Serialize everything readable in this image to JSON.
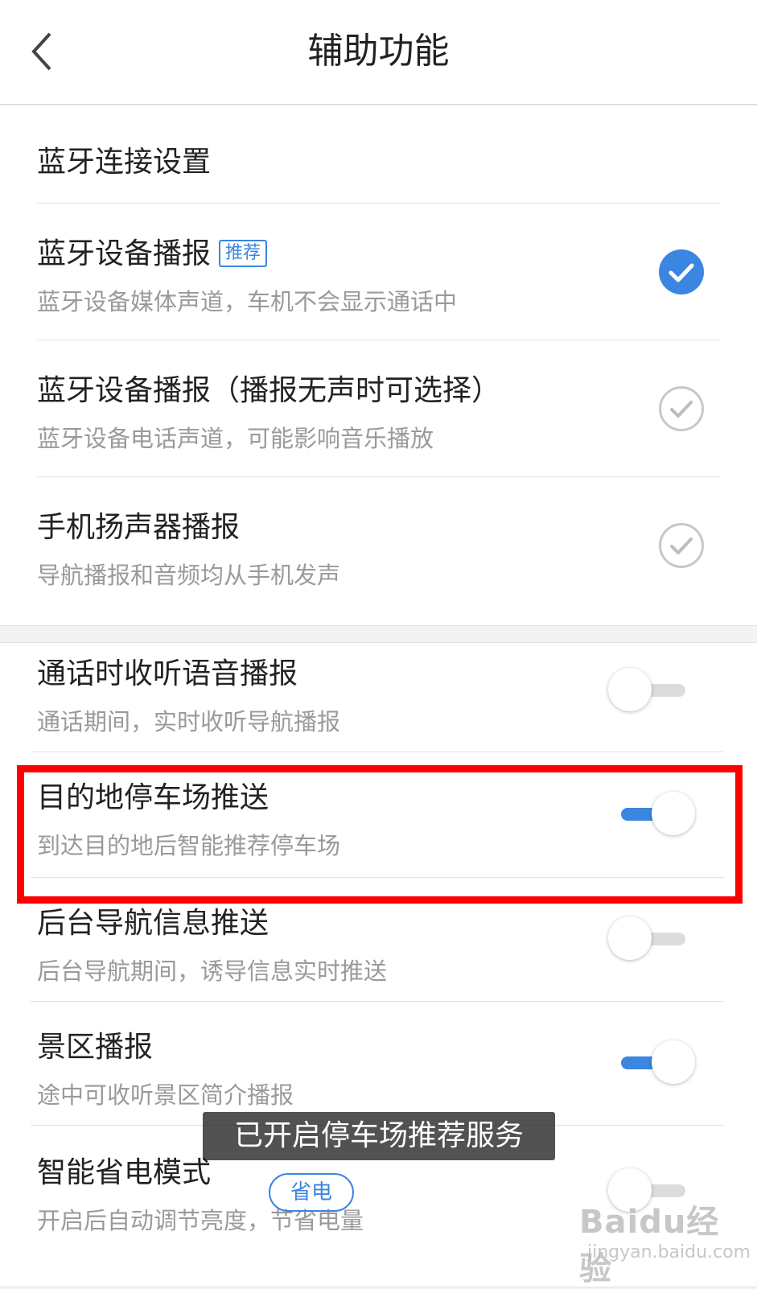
{
  "header": {
    "title": "辅助功能"
  },
  "audio_group": {
    "section_title": "蓝牙连接设置",
    "options": [
      {
        "title": "蓝牙设备播报",
        "tag": "推荐",
        "subtitle": "蓝牙设备媒体声道，车机不会显示通话中",
        "selected": true
      },
      {
        "title": "蓝牙设备播报（播报无声时可选择）",
        "subtitle": "蓝牙设备电话声道，可能影响音乐播放",
        "selected": false
      },
      {
        "title": "手机扬声器播报",
        "subtitle": "导航播报和音频均从手机发声",
        "selected": false
      }
    ]
  },
  "toggle_group": {
    "items": [
      {
        "title": "通话时收听语音播报",
        "subtitle": "通话期间，实时收听导航播报",
        "enabled": false
      },
      {
        "title": "目的地停车场推送",
        "subtitle": "到达目的地后智能推荐停车场",
        "enabled": true
      },
      {
        "title": "后台导航信息推送",
        "subtitle": "后台导航期间，诱导信息实时推送",
        "enabled": false
      },
      {
        "title": "景区播报",
        "subtitle": "途中可收听景区简介播报",
        "enabled": true
      },
      {
        "title": "智能省电模式",
        "tag": "省电",
        "subtitle": "开启后自动调节亮度，节省电量",
        "enabled": false
      }
    ]
  },
  "toast": {
    "message": "已开启停车场推荐服务"
  },
  "watermark": {
    "logo_text": "Baidu经验",
    "url_text": "jingyan.baidu.com"
  },
  "colors": {
    "accent": "#3a86e0",
    "highlight_border": "#ff0000",
    "toggle_off": "#dcdcdc"
  }
}
